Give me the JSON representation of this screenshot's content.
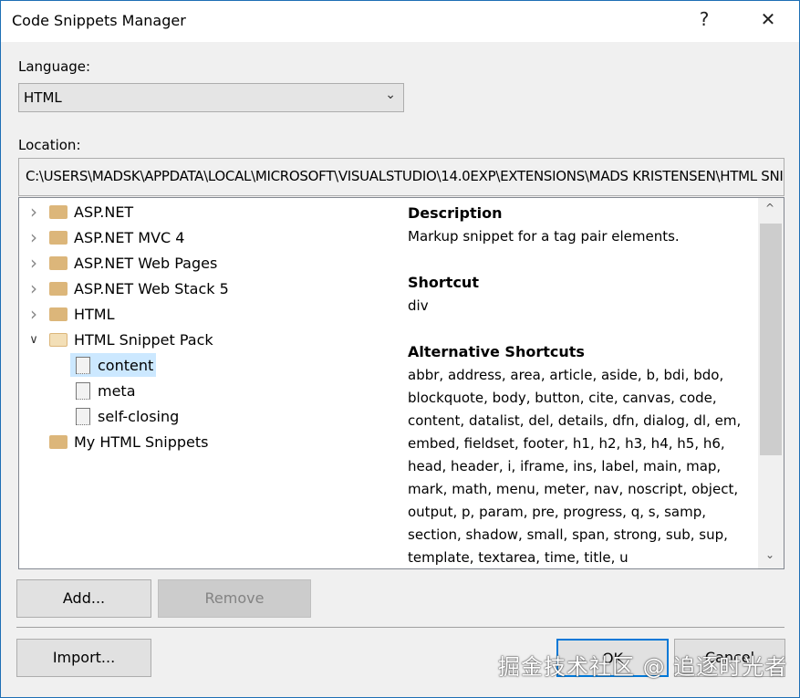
{
  "window": {
    "title": "Code Snippets Manager",
    "help_label": "?",
    "close_label": "✕"
  },
  "language": {
    "label": "Language:",
    "value": "HTML"
  },
  "location": {
    "label": "Location:",
    "value": "C:\\USERS\\MADSK\\APPDATA\\LOCAL\\MICROSOFT\\VISUALSTUDIO\\14.0EXP\\EXTENSIONS\\MADS KRISTENSEN\\HTML SNIPPET PACK"
  },
  "tree": {
    "items": [
      {
        "label": "ASP.NET",
        "type": "folder",
        "expanded": false
      },
      {
        "label": "ASP.NET MVC 4",
        "type": "folder",
        "expanded": false
      },
      {
        "label": "ASP.NET Web Pages",
        "type": "folder",
        "expanded": false
      },
      {
        "label": "ASP.NET Web Stack 5",
        "type": "folder",
        "expanded": false
      },
      {
        "label": "HTML",
        "type": "folder",
        "expanded": false
      },
      {
        "label": "HTML Snippet Pack",
        "type": "folder",
        "expanded": true
      },
      {
        "label": "content",
        "type": "snippet",
        "selected": true
      },
      {
        "label": "meta",
        "type": "snippet"
      },
      {
        "label": "self-closing",
        "type": "snippet"
      },
      {
        "label": "My HTML Snippets",
        "type": "folder"
      }
    ]
  },
  "details": {
    "description_heading": "Description",
    "description": "Markup snippet for a tag pair elements.",
    "shortcut_heading": "Shortcut",
    "shortcut": "div",
    "alt_heading": "Alternative Shortcuts",
    "alt_shortcuts": "abbr, address, area, article, aside, b, bdi, bdo, blockquote, body, button, cite, canvas, code, content, datalist, del, details, dfn, dialog, dl, em, embed, fieldset, footer, h1, h2, h3, h4, h5, h6, head, header, i, iframe, ins, label, main, map, mark, math, menu, meter, nav, noscript, object, output, p, param, pre, progress, q, s, samp, section, shadow, small, span, strong, sub, sup, template, textarea, time, title, u"
  },
  "buttons": {
    "add": "Add...",
    "remove": "Remove",
    "import": "Import...",
    "ok": "OK",
    "cancel": "Cancel"
  },
  "watermark": "掘金技术社区 @ 追逐时光者"
}
